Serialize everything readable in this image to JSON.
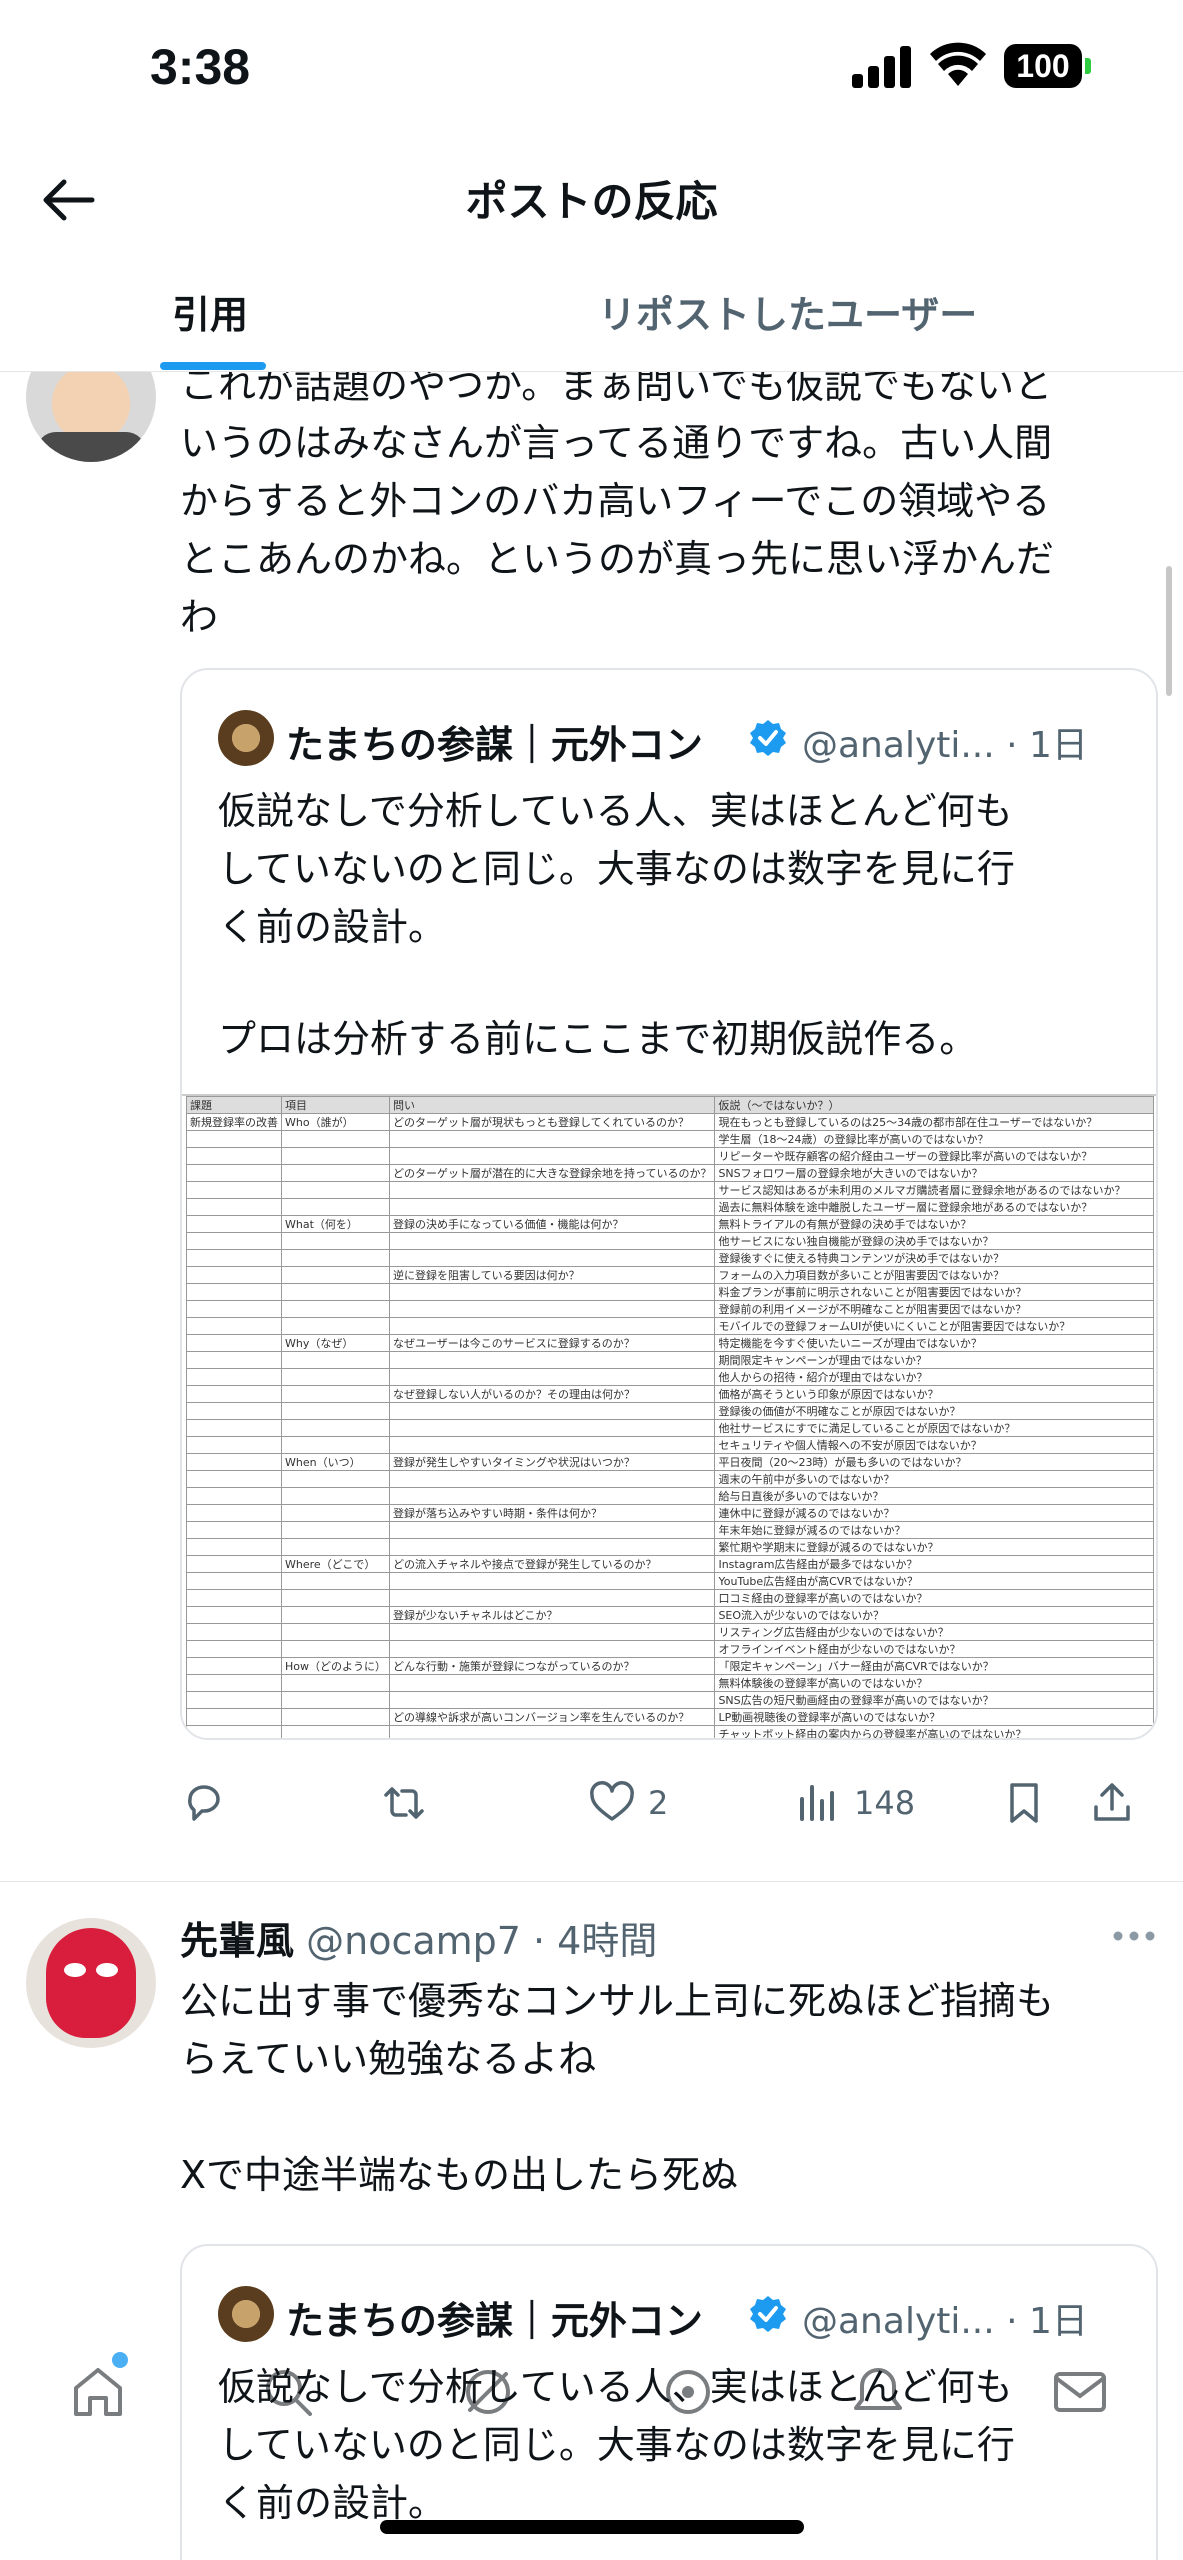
{
  "status_bar": {
    "time": "3:38",
    "battery": "100"
  },
  "header": {
    "title": "ポストの反応"
  },
  "tabs": [
    {
      "label": "引用",
      "active": true
    },
    {
      "label": "リポストしたユーザー",
      "active": false
    }
  ],
  "posts": [
    {
      "text_lines": [
        "これが話題のやつか。まぁ問いでも仮説でもないと",
        "いうのはみなさんが言ってる通りですね。古い人間",
        "からすると外コンのバカ高いフィーでこの領域やる",
        "とこあんのかね。というのが真っ先に思い浮かんだ",
        "わ"
      ],
      "quote": {
        "name": "たまちの参謀｜元外コン",
        "handle_time": "@analyti... · 1日",
        "text_lines": [
          "仮説なしで分析している人、実はほとんど何も",
          "していないのと同じ。大事なのは数字を見に行",
          "く前の設計。"
        ],
        "text2": "プロは分析する前にここまで初期仮説作る。",
        "table": {
          "headers": [
            "課題",
            "項目",
            "問い",
            "仮説（〜ではないか？）"
          ],
          "rows": [
            [
              "新規登録率の改善",
              "Who（誰が）",
              "どのターゲット層が現状もっとも登録してくれているのか？",
              "現在もっとも登録しているのは25〜34歳の都市部在住ユーザーではないか？"
            ],
            [
              "",
              "",
              "",
              "学生層（18〜24歳）の登録比率が高いのではないか？"
            ],
            [
              "",
              "",
              "",
              "リピーターや既存顧客の紹介経由ユーザーの登録比率が高いのではないか？"
            ],
            [
              "",
              "",
              "どのターゲット層が潜在的に大きな登録余地を持っているのか？",
              "SNSフォロワー層の登録余地が大きいのではないか？"
            ],
            [
              "",
              "",
              "",
              "サービス認知はあるが未利用のメルマガ購読者層に登録余地があるのではないか？"
            ],
            [
              "",
              "",
              "",
              "過去に無料体験を途中離脱したユーザー層に登録余地があるのではないか？"
            ],
            [
              "",
              "What（何を）",
              "登録の決め手になっている価値・機能は何か？",
              "無料トライアルの有無が登録の決め手ではないか？"
            ],
            [
              "",
              "",
              "",
              "他サービスにない独自機能が登録の決め手ではないか？"
            ],
            [
              "",
              "",
              "",
              "登録後すぐに使える特典コンテンツが決め手ではないか？"
            ],
            [
              "",
              "",
              "逆に登録を阻害している要因は何か？",
              "フォームの入力項目数が多いことが阻害要因ではないか？"
            ],
            [
              "",
              "",
              "",
              "料金プランが事前に明示されないことが阻害要因ではないか？"
            ],
            [
              "",
              "",
              "",
              "登録前の利用イメージが不明確なことが阻害要因ではないか？"
            ],
            [
              "",
              "",
              "",
              "モバイルでの登録フォームUIが使いにくいことが阻害要因ではないか？"
            ],
            [
              "",
              "Why（なぜ）",
              "なぜユーザーは今このサービスに登録するのか？",
              "特定機能を今すぐ使いたいニーズが理由ではないか？"
            ],
            [
              "",
              "",
              "",
              "期間限定キャンペーンが理由ではないか？"
            ],
            [
              "",
              "",
              "",
              "他人からの招待・紹介が理由ではないか？"
            ],
            [
              "",
              "",
              "なぜ登録しない人がいるのか？その理由は何か？",
              "価格が高そうという印象が原因ではないか？"
            ],
            [
              "",
              "",
              "",
              "登録後の価値が不明確なことが原因ではないか？"
            ],
            [
              "",
              "",
              "",
              "他社サービスにすでに満足していることが原因ではないか？"
            ],
            [
              "",
              "",
              "",
              "セキュリティや個人情報への不安が原因ではないか？"
            ],
            [
              "",
              "When（いつ）",
              "登録が発生しやすいタイミングや状況はいつか？",
              "平日夜間（20〜23時）が最も多いのではないか？"
            ],
            [
              "",
              "",
              "",
              "週末の午前中が多いのではないか？"
            ],
            [
              "",
              "",
              "",
              "給与日直後が多いのではないか？"
            ],
            [
              "",
              "",
              "登録が落ち込みやすい時期・条件は何か？",
              "連休中に登録が減るのではないか？"
            ],
            [
              "",
              "",
              "",
              "年末年始に登録が減るのではないか？"
            ],
            [
              "",
              "",
              "",
              "繁忙期や学期末に登録が減るのではないか？"
            ],
            [
              "",
              "Where（どこで）",
              "どの流入チャネルや接点で登録が発生しているのか？",
              "Instagram広告経由が最多ではないか？"
            ],
            [
              "",
              "",
              "",
              "YouTube広告経由が高CVRではないか？"
            ],
            [
              "",
              "",
              "",
              "口コミ経由の登録率が高いのではないか？"
            ],
            [
              "",
              "",
              "登録が少ないチャネルはどこか？",
              "SEO流入が少ないのではないか？"
            ],
            [
              "",
              "",
              "",
              "リスティング広告経由が少ないのではないか？"
            ],
            [
              "",
              "",
              "",
              "オフラインイベント経由が少ないのではないか？"
            ],
            [
              "",
              "How（どのように）",
              "どんな行動・施策が登録につながっているのか？",
              "「限定キャンペーン」バナー経由が高CVRではないか？"
            ],
            [
              "",
              "",
              "",
              "無料体験後の登録率が高いのではないか？"
            ],
            [
              "",
              "",
              "",
              "SNS広告の短尺動画経由の登録率が高いのではないか？"
            ],
            [
              "",
              "",
              "どの導線や訴求が高いコンバージョン率を生んでいるのか？",
              "LP動画視聴後の登録率が高いのではないか？"
            ],
            [
              "",
              "",
              "",
              "チャットボット経由の案内からの登録率が高いのではないか？"
            ]
          ]
        }
      },
      "actions": {
        "reply": "",
        "repost": "",
        "likes": "2",
        "views": "148"
      }
    },
    {
      "name": "先輩風",
      "handle_time": "@nocamp7 · 4時間",
      "text_lines": [
        "公に出す事で優秀なコンサル上司に死ぬほど指摘も",
        "らえていい勉強なるよね",
        "",
        "Xで中途半端なもの出したら死ぬ"
      ],
      "quote": {
        "name": "たまちの参謀｜元外コン",
        "handle_time": "@analyti... · 1日",
        "text_lines": [
          "仮説なしで分析している人、実はほとんど何も",
          "していないのと同じ。大事なのは数字を見に行",
          "く前の設計。"
        ]
      }
    }
  ],
  "colors": {
    "accent": "#1d9bf0",
    "secondary_text": "#536471",
    "verified": "#1d9bf0"
  }
}
